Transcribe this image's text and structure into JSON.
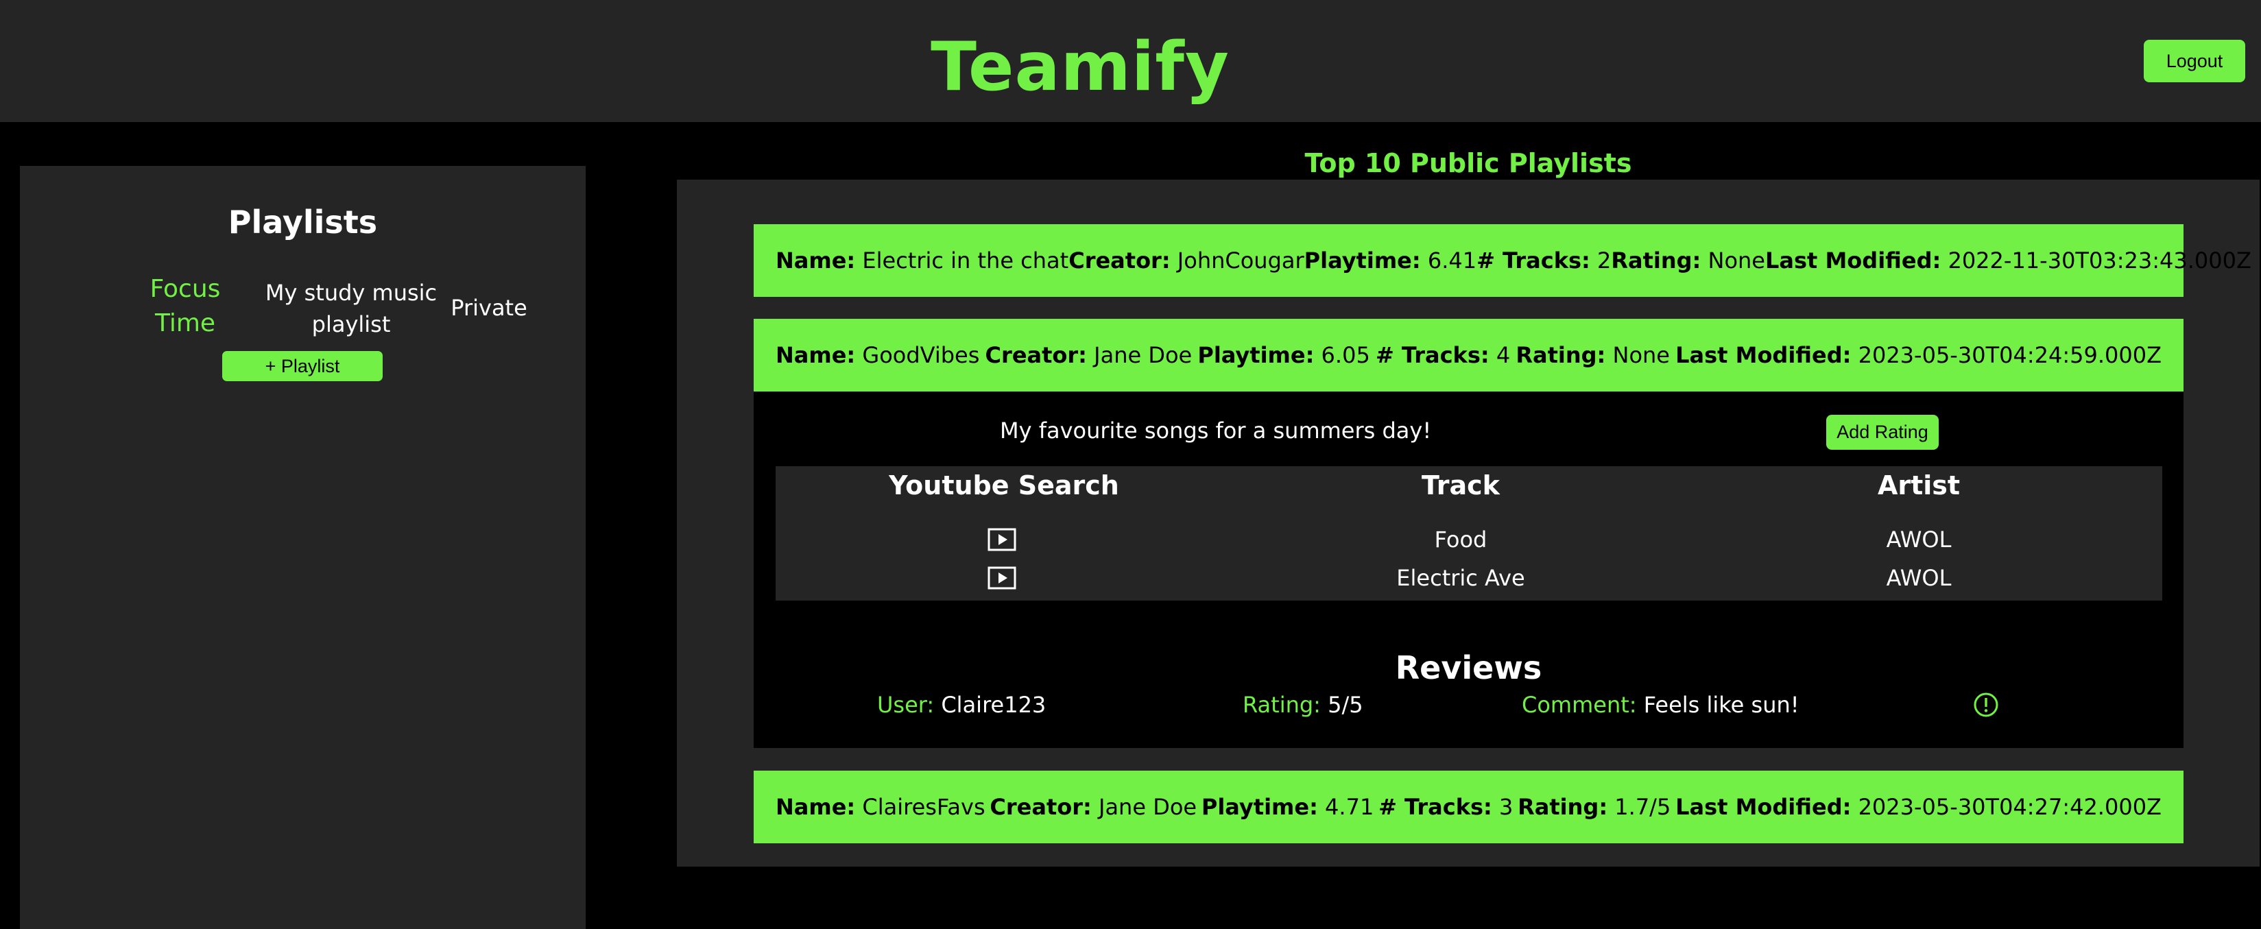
{
  "header": {
    "title": "Teamify",
    "logout_label": "Logout"
  },
  "sidebar": {
    "title": "Playlists",
    "items": [
      {
        "label": "Focus Time"
      },
      {
        "label": "My study music playlist"
      },
      {
        "label": "Private"
      }
    ],
    "add_playlist_label": "+ Playlist"
  },
  "main": {
    "heading": "Top 10 Public Playlists",
    "labels": {
      "name": "Name:",
      "creator": "Creator:",
      "playtime": "Playtime:",
      "tracks": "# Tracks:",
      "rating": "Rating:",
      "last_modified": "Last Modified:"
    },
    "playlists": [
      {
        "name": "Electric in the chat",
        "creator": "JohnCougar",
        "playtime": "6.41",
        "tracks": "2",
        "rating": "None",
        "last_modified": "2022-11-30T03:23:43.000Z"
      },
      {
        "name": "GoodVibes",
        "creator": "Jane Doe",
        "playtime": "6.05",
        "tracks": "4",
        "rating": "None",
        "last_modified": "2023-05-30T04:24:59.000Z"
      },
      {
        "name": "ClairesFavs",
        "creator": "Jane Doe",
        "playtime": "4.71",
        "tracks": "3",
        "rating": "1.7/5",
        "last_modified": "2023-05-30T04:27:42.000Z"
      }
    ],
    "expanded": {
      "description": "My favourite songs for a summers day!",
      "add_rating_label": "Add Rating",
      "table_headers": [
        "Youtube Search",
        "Track",
        "Artist"
      ],
      "tracks": [
        {
          "track": "Food",
          "artist": "AWOL"
        },
        {
          "track": "Electric Ave",
          "artist": "AWOL"
        }
      ],
      "reviews_title": "Reviews",
      "review_labels": {
        "user": "User:",
        "rating": "Rating:",
        "comment": "Comment:"
      },
      "reviews": [
        {
          "user": "Claire123",
          "rating": "5/5",
          "comment": "Feels like sun!"
        }
      ]
    }
  },
  "icons": {
    "youtube": "play-square-icon",
    "report": "exclamation-circle-icon"
  },
  "colors": {
    "accent": "#73f046",
    "panel": "#252525",
    "background": "#000000"
  }
}
